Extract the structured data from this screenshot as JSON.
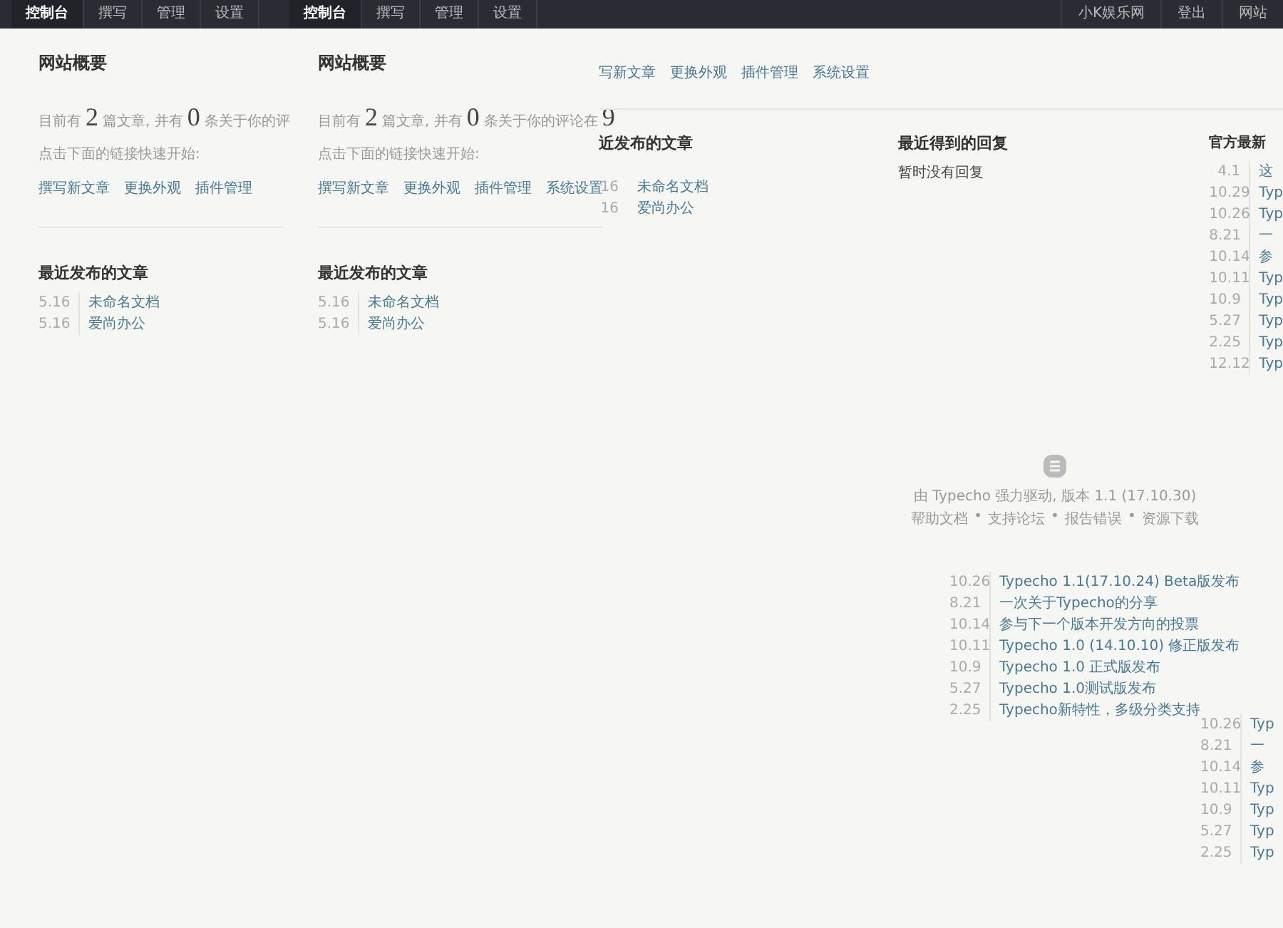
{
  "top_bar": {
    "nav_groups": [
      {
        "tabs": [
          {
            "label": "控制台",
            "selected": true
          },
          {
            "label": "撰写",
            "selected": false
          },
          {
            "label": "管理",
            "selected": false
          },
          {
            "label": "设置",
            "selected": false
          }
        ]
      },
      {
        "tabs": [
          {
            "label": "控制台",
            "selected": true
          },
          {
            "label": "撰写",
            "selected": false
          },
          {
            "label": "管理",
            "selected": false
          },
          {
            "label": "设置",
            "selected": false
          }
        ]
      }
    ],
    "user_links": [
      "小K娱乐网",
      "登出",
      "网站"
    ]
  },
  "overview_panels": [
    {
      "title": "网站概要",
      "summary": [
        {
          "kind": "text",
          "text": "目前有"
        },
        {
          "kind": "number",
          "text": "2"
        },
        {
          "kind": "text",
          "text": "篇文章, 并有"
        },
        {
          "kind": "number",
          "text": "0"
        },
        {
          "kind": "text",
          "text": "条关于你的评"
        }
      ],
      "quick_start": "点击下面的链接快速开始:",
      "links": [
        "撰写新文章",
        "更换外观",
        "插件管理"
      ],
      "recent_title": "最近发布的文章",
      "recent_posts": [
        {
          "date": "5.16",
          "title": "未命名文档"
        },
        {
          "date": "5.16",
          "title": "爱尚办公"
        }
      ]
    },
    {
      "title": "网站概要",
      "summary": [
        {
          "kind": "text",
          "text": "目前有"
        },
        {
          "kind": "number",
          "text": "2"
        },
        {
          "kind": "text",
          "text": "篇文章, 并有"
        },
        {
          "kind": "number",
          "text": "0"
        },
        {
          "kind": "text",
          "text": "条关于你的评论在"
        },
        {
          "kind": "number",
          "text": "9"
        }
      ],
      "quick_start": "点击下面的链接快速开始:",
      "links": [
        "撰写新文章",
        "更换外观",
        "插件管理",
        "系统设置"
      ],
      "recent_title": "最近发布的文章",
      "recent_posts": [
        {
          "date": "5.16",
          "title": "未命名文档"
        },
        {
          "date": "5.16",
          "title": "爱尚办公"
        }
      ]
    }
  ],
  "main_panel": {
    "links": [
      "写新文章",
      "更换外观",
      "插件管理",
      "系统设置"
    ],
    "recent": {
      "title": "近发布的文章",
      "posts": [
        {
          "date": "16",
          "title": "未命名文档"
        },
        {
          "date": "16",
          "title": "爱尚办公"
        }
      ]
    },
    "replies": {
      "title": "最近得到的回复",
      "empty": "暂时没有回复"
    },
    "news": {
      "title": "官方最新",
      "items": [
        {
          "date": "4.1",
          "title": "这"
        },
        {
          "date": "10.29",
          "title": "Typ"
        },
        {
          "date": "10.26",
          "title": "Typ"
        },
        {
          "date": "8.21",
          "title": "一"
        },
        {
          "date": "10.14",
          "title": "参"
        },
        {
          "date": "10.11",
          "title": "Typ"
        },
        {
          "date": "10.9",
          "title": "Typ"
        },
        {
          "date": "5.27",
          "title": "Typ"
        },
        {
          "date": "2.25",
          "title": "Typ"
        },
        {
          "date": "12.12",
          "title": "Typ"
        }
      ]
    }
  },
  "footer": {
    "powered_by": "由 Typecho 强力驱动, 版本 1.1 (17.10.30)",
    "links": [
      "帮助文档",
      "支持论坛",
      "报告错误",
      "资源下载"
    ],
    "separator": "•"
  },
  "news_list": [
    {
      "date": "10.26",
      "title": "Typecho 1.1(17.10.24) Beta版发布"
    },
    {
      "date": "8.21",
      "title": "一次关于Typecho的分享"
    },
    {
      "date": "10.14",
      "title": "参与下一个版本开发方向的投票"
    },
    {
      "date": "10.11",
      "title": "Typecho 1.0 (14.10.10) 修正版发布"
    },
    {
      "date": "10.9",
      "title": "Typecho 1.0 正式版发布"
    },
    {
      "date": "5.27",
      "title": "Typecho 1.0测试版发布"
    },
    {
      "date": "2.25",
      "title": "Typecho新特性，多级分类支持"
    }
  ],
  "news_list_edge": [
    {
      "date": "10.26",
      "title": "Typ"
    },
    {
      "date": "8.21",
      "title": "一"
    },
    {
      "date": "10.14",
      "title": "参"
    },
    {
      "date": "10.11",
      "title": "Typ"
    },
    {
      "date": "10.9",
      "title": "Typ"
    },
    {
      "date": "5.27",
      "title": "Typ"
    },
    {
      "date": "2.25",
      "title": "Typ"
    }
  ]
}
